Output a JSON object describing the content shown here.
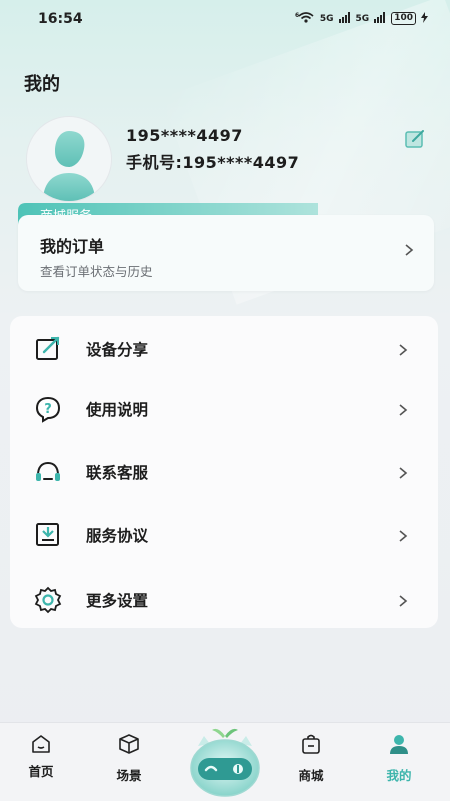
{
  "status_bar": {
    "time": "16:54",
    "battery": "100",
    "signal_1": "5G",
    "signal_2": "5G",
    "wifi_tag": "6"
  },
  "page": {
    "title": "我的"
  },
  "profile": {
    "account": "195****4497",
    "phone_line": "手机号:195****4497"
  },
  "order_section": {
    "tab_label": "商城服务",
    "title": "我的订单",
    "subtitle": "查看订单状态与历史"
  },
  "menu": {
    "items": [
      {
        "label": "设备分享",
        "icon": "share-icon"
      },
      {
        "label": "使用说明",
        "icon": "help-icon"
      },
      {
        "label": "联系客服",
        "icon": "headset-icon"
      },
      {
        "label": "服务协议",
        "icon": "agreement-icon"
      },
      {
        "label": "更多设置",
        "icon": "settings-icon"
      }
    ]
  },
  "tabbar": {
    "items": [
      {
        "label": "首页",
        "icon": "home-icon"
      },
      {
        "label": "场景",
        "icon": "cube-icon"
      },
      {
        "label": "",
        "icon": "robot-icon"
      },
      {
        "label": "商城",
        "icon": "shop-bag-icon"
      },
      {
        "label": "我的",
        "icon": "profile-icon",
        "active": true
      }
    ]
  },
  "colors": {
    "accent": "#3db5ac",
    "tab_gradient_start": "#4ec3b7",
    "tab_gradient_end": "#aee3dc"
  }
}
